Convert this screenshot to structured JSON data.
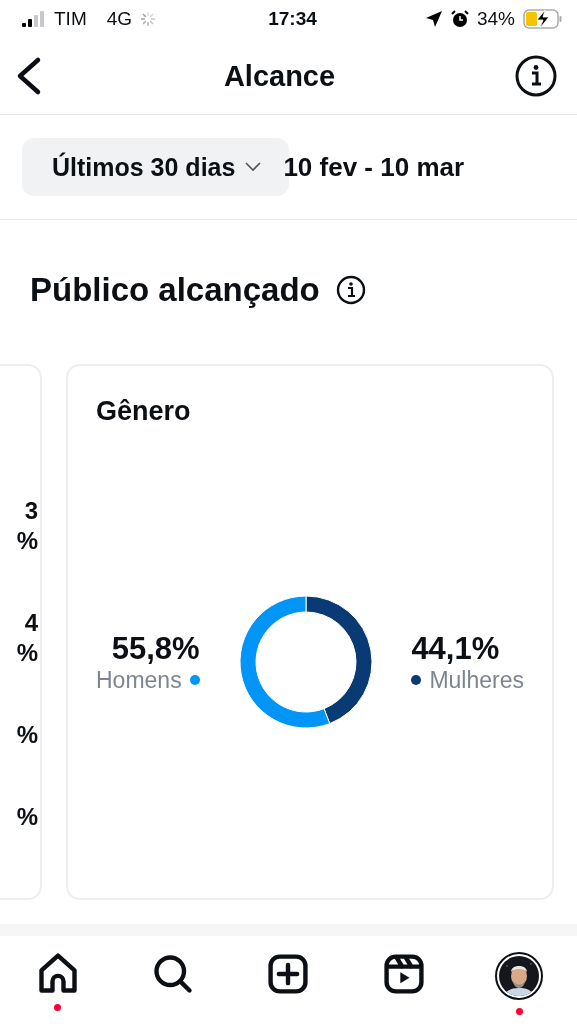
{
  "status_bar": {
    "carrier": "TIM",
    "network": "4G",
    "time": "17:34",
    "battery": "34%",
    "charging": true
  },
  "header": {
    "title": "Alcance"
  },
  "filter": {
    "period": "Últimos 30 dias",
    "range": "10 fev - 10 mar"
  },
  "section": {
    "title": "Público alcançado"
  },
  "previous_card": {
    "lines": [
      [
        "3",
        "%"
      ],
      [
        "4",
        "%"
      ],
      [
        "%"
      ],
      [
        "%"
      ]
    ]
  },
  "gender_card": {
    "legend": [
      {
        "value": "55,8%",
        "color": "#0095f6"
      },
      {
        "value": "44,1%",
        "color": "#0a3a73"
      }
    ],
    "chart_data": {
      "type": "donut",
      "categories": [
        "Homens",
        "Mulheres"
      ],
      "series": [
        {
          "name": "Gênero",
          "values": [
            55.8,
            44.1
          ]
        }
      ]
    }
  },
  "bottom_nav": [
    {
      "kind": "home",
      "badge": true
    },
    {
      "kind": "search",
      "badge": false
    },
    {
      "kind": "create",
      "badge": false
    },
    {
      "kind": "reels",
      "badge": false
    },
    {
      "kind": "profile",
      "badge": true
    }
  ]
}
